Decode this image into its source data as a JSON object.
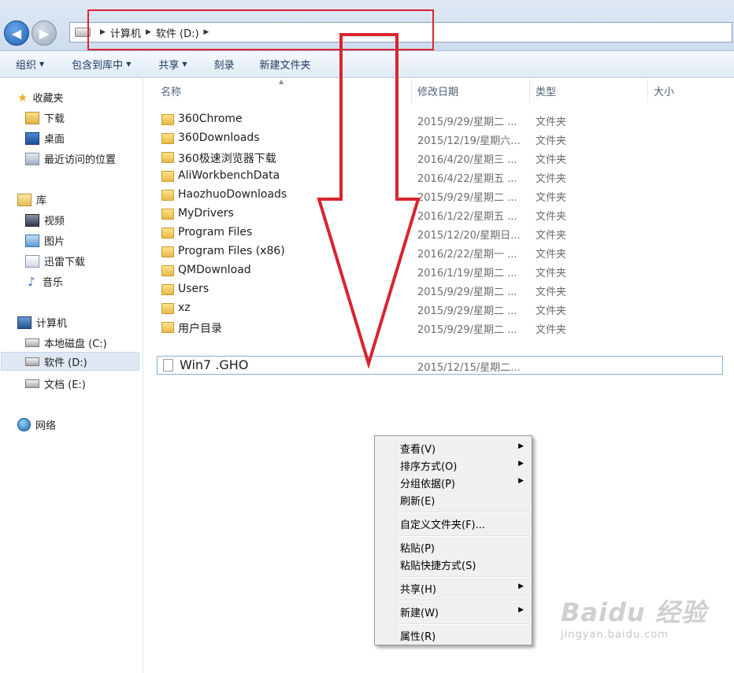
{
  "breadcrumb": {
    "root": "计算机",
    "current": "软件 (D:)"
  },
  "toolbar": {
    "organize": "组织",
    "include": "包含到库中",
    "share": "共享",
    "burn": "刻录",
    "new_folder": "新建文件夹"
  },
  "sidebar": {
    "favorites": {
      "label": "收藏夹",
      "items": [
        "下载",
        "桌面",
        "最近访问的位置"
      ]
    },
    "libraries": {
      "label": "库",
      "items": [
        "视频",
        "图片",
        "迅雷下载",
        "音乐"
      ]
    },
    "computer": {
      "label": "计算机",
      "items": [
        "本地磁盘 (C:)",
        "软件 (D:)",
        "文档 (E:)"
      ]
    },
    "network": {
      "label": "网络"
    }
  },
  "columns": {
    "name": "名称",
    "date": "修改日期",
    "type": "类型",
    "size": "大小"
  },
  "files": [
    {
      "name": "360Chrome",
      "date": "2015/9/29/星期二 ...",
      "type": "文件夹"
    },
    {
      "name": "360Downloads",
      "date": "2015/12/19/星期六...",
      "type": "文件夹"
    },
    {
      "name": "360极速浏览器下载",
      "date": "2016/4/20/星期三 ...",
      "type": "文件夹"
    },
    {
      "name": "AliWorkbenchData",
      "date": "2016/4/22/星期五 ...",
      "type": "文件夹"
    },
    {
      "name": "HaozhuoDownloads",
      "date": "2015/9/29/星期二 ...",
      "type": "文件夹"
    },
    {
      "name": "MyDrivers",
      "date": "2016/1/22/星期五 ...",
      "type": "文件夹"
    },
    {
      "name": "Program Files",
      "date": "2015/12/20/星期日...",
      "type": "文件夹"
    },
    {
      "name": "Program Files (x86)",
      "date": "2016/2/22/星期一 ...",
      "type": "文件夹"
    },
    {
      "name": "QMDownload",
      "date": "2016/1/19/星期二 ...",
      "type": "文件夹"
    },
    {
      "name": "Users",
      "date": "2015/9/29/星期二 ...",
      "type": "文件夹"
    },
    {
      "name": "xz",
      "date": "2015/9/29/星期二 ...",
      "type": "文件夹"
    },
    {
      "name": "用户目录",
      "date": "2015/9/29/星期二 ...",
      "type": "文件夹"
    }
  ],
  "gho_file": {
    "name": "Win7 .GHO",
    "date": "2015/12/15/星期二..."
  },
  "context_menu": {
    "view": "查看(V)",
    "sort": "排序方式(O)",
    "group": "分组依据(P)",
    "refresh": "刷新(E)",
    "customize": "自定义文件夹(F)...",
    "paste": "粘贴(P)",
    "paste_shortcut": "粘贴快捷方式(S)",
    "share": "共享(H)",
    "new": "新建(W)",
    "properties": "属性(R)"
  },
  "watermark": {
    "logo": "Baidu 经验",
    "url": "jingyan.baidu.com"
  },
  "colors": {
    "annotation_red": "#d9242e",
    "selection": "#dfe8f3"
  }
}
